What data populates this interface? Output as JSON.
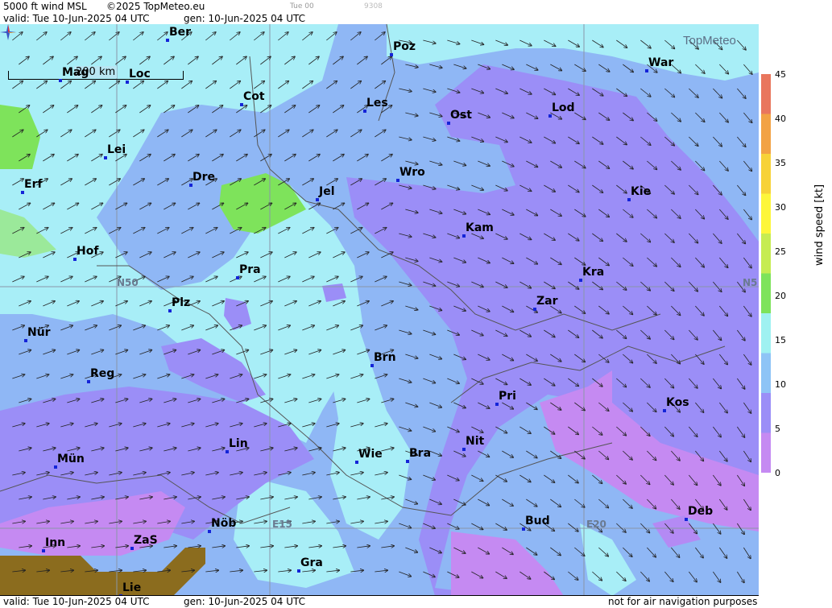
{
  "header": {
    "product": "5000 ft wind MSL",
    "copyright": "©2025 TopMeteo.eu",
    "valid": "valid:  Tue  10-Jun-2025  04 UTC",
    "gen": "gen: 10-Jun-2025 04 UTC",
    "step": "Tue 00",
    "code": "9308"
  },
  "footer": {
    "valid": "valid:  Tue  10-Jun-2025  04 UTC",
    "gen": "gen: 10-Jun-2025 04 UTC",
    "disclaimer": "not for air navigation purposes"
  },
  "logo": {
    "text": "TopMeteo"
  },
  "scale_bar": {
    "label": "200 km"
  },
  "gridlines": {
    "lat": "N50",
    "lat_right": "N5",
    "lon1": "E15",
    "lon2": "E20"
  },
  "legend": {
    "title": "wind  speed  [kt]",
    "ticks": [
      "45",
      "40",
      "35",
      "30",
      "25",
      "20",
      "15",
      "10",
      "5",
      "0"
    ],
    "colors": [
      "#e9765d",
      "#f2a244",
      "#f7d238",
      "#fdf63a",
      "#c6ec52",
      "#7ee35b",
      "#9ff1f1",
      "#8ec4f6",
      "#9b8ef7",
      "#c58af2"
    ]
  },
  "cities": [
    {
      "name": "Ber"
    },
    {
      "name": "Poz"
    },
    {
      "name": "War"
    },
    {
      "name": "Mag"
    },
    {
      "name": "Loc"
    },
    {
      "name": "Cot"
    },
    {
      "name": "Les"
    },
    {
      "name": "Ost"
    },
    {
      "name": "Lod"
    },
    {
      "name": "Lei"
    },
    {
      "name": "Dre"
    },
    {
      "name": "Wro"
    },
    {
      "name": "Jel"
    },
    {
      "name": "Kie"
    },
    {
      "name": "Erf"
    },
    {
      "name": "Kam"
    },
    {
      "name": "Hof"
    },
    {
      "name": "Pra"
    },
    {
      "name": "Kra"
    },
    {
      "name": "Zar"
    },
    {
      "name": "Plz"
    },
    {
      "name": "Nür"
    },
    {
      "name": "Brn"
    },
    {
      "name": "Reg"
    },
    {
      "name": "Pri"
    },
    {
      "name": "Kos"
    },
    {
      "name": "Lin"
    },
    {
      "name": "Nit"
    },
    {
      "name": "Mün"
    },
    {
      "name": "Wie"
    },
    {
      "name": "Bra"
    },
    {
      "name": "Deb"
    },
    {
      "name": "Nöb"
    },
    {
      "name": "Bud"
    },
    {
      "name": "Inn"
    },
    {
      "name": "ZaS"
    },
    {
      "name": "Gra"
    },
    {
      "name": "Lie"
    }
  ]
}
